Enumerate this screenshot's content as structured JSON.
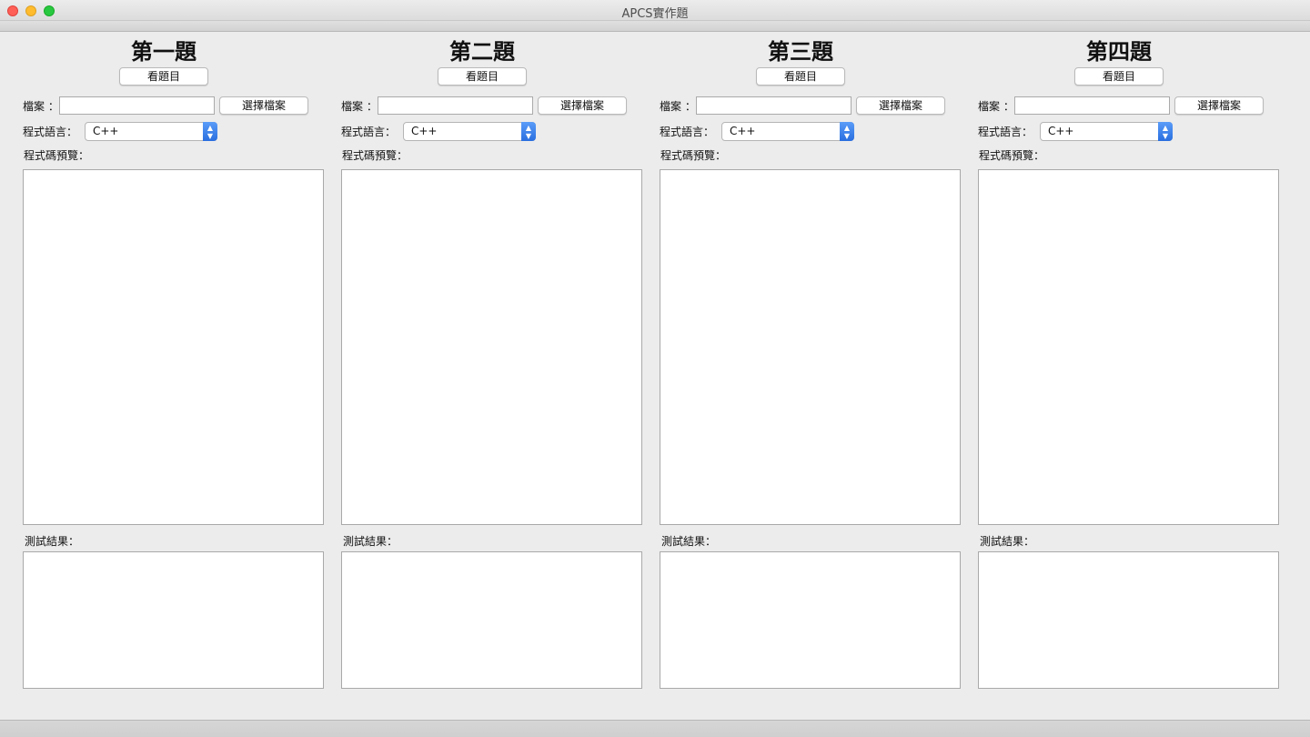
{
  "window": {
    "title": "APCS實作題"
  },
  "labels": {
    "view_problem": "看題目",
    "file": "檔案 ：",
    "choose_file": "選擇檔案",
    "language": "程式語言：",
    "code_preview": "程式碼預覽：",
    "test_result": "測試結果："
  },
  "questions": [
    {
      "title": "第一題",
      "file_value": "",
      "language": "C++"
    },
    {
      "title": "第二題",
      "file_value": "",
      "language": "C++"
    },
    {
      "title": "第三題",
      "file_value": "",
      "language": "C++"
    },
    {
      "title": "第四題",
      "file_value": "",
      "language": "C++"
    }
  ],
  "icons": {
    "close": "close-dot",
    "minimize": "minimize-dot",
    "maximize": "maximize-dot",
    "select_arrows": "chevron-updown-icon"
  },
  "colors": {
    "close": "#fe5f57",
    "minimize": "#febc2e",
    "maximize": "#28c840",
    "select_accent": "#2a6fe0",
    "window_bg": "#ececec"
  }
}
